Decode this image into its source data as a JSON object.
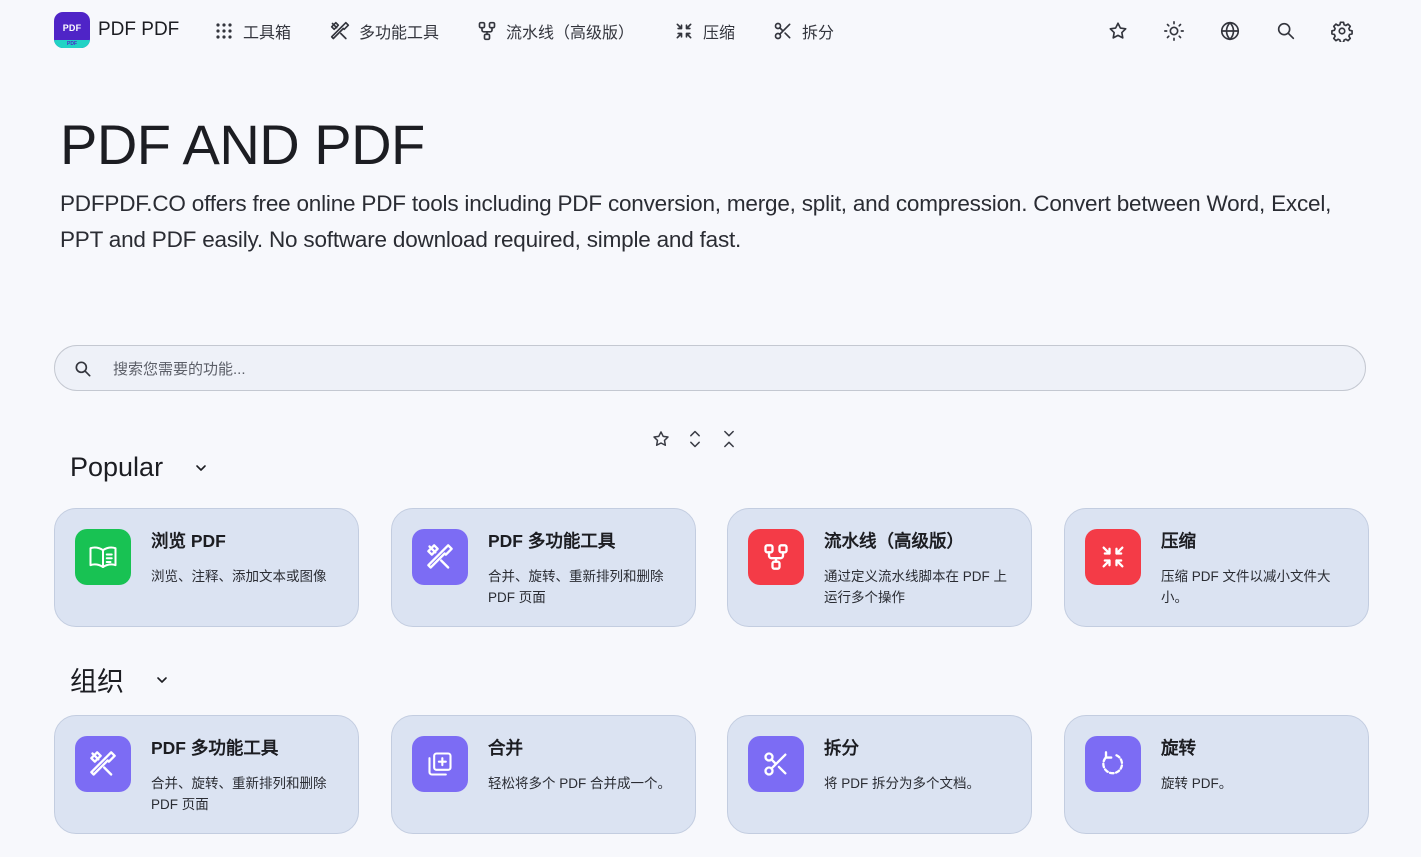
{
  "brand": {
    "logo_text": "PDF",
    "logo_sub": "PDF",
    "name": "PDF PDF"
  },
  "nav": [
    {
      "label": "工具箱",
      "icon": "grid-icon"
    },
    {
      "label": "多功能工具",
      "icon": "tools-icon"
    },
    {
      "label": "流水线（高级版）",
      "icon": "pipeline-icon"
    },
    {
      "label": "压缩",
      "icon": "compress-icon"
    },
    {
      "label": "拆分",
      "icon": "scissors-icon"
    }
  ],
  "top_icons": [
    "star-icon",
    "sun-icon",
    "globe-icon",
    "search-icon",
    "gear-icon"
  ],
  "hero": {
    "title": "PDF AND PDF",
    "description": "PDFPDF.CO offers free online PDF tools including PDF conversion, merge, split, and compression. Convert between Word, Excel, PPT and PDF easily. No software download required, simple and fast."
  },
  "search": {
    "placeholder": "搜索您需要的功能...",
    "value": ""
  },
  "controls": [
    "star-outline-icon",
    "expand-all-icon",
    "collapse-all-icon"
  ],
  "sections": [
    {
      "title": "Popular",
      "cards": [
        {
          "title": "浏览 PDF",
          "desc": "浏览、注释、添加文本或图像",
          "icon": "book-icon",
          "color": "#18c253"
        },
        {
          "title": "PDF 多功能工具",
          "desc": "合并、旋转、重新排列和删除 PDF 页面",
          "icon": "tools-icon",
          "color": "#7c6cf4"
        },
        {
          "title": "流水线（高级版）",
          "desc": "通过定义流水线脚本在 PDF 上运行多个操作",
          "icon": "pipeline-icon",
          "color": "#f43b47"
        },
        {
          "title": "压缩",
          "desc": "压缩 PDF 文件以减小文件大小。",
          "icon": "compress-icon",
          "color": "#f43b47"
        }
      ]
    },
    {
      "title": "组织",
      "cards": [
        {
          "title": "PDF 多功能工具",
          "desc": "合并、旋转、重新排列和删除 PDF 页面",
          "icon": "tools-icon",
          "color": "#7c6cf4"
        },
        {
          "title": "合并",
          "desc": "轻松将多个 PDF 合并成一个。",
          "icon": "merge-icon",
          "color": "#7c6cf4"
        },
        {
          "title": "拆分",
          "desc": "将 PDF 拆分为多个文档。",
          "icon": "scissors-icon",
          "color": "#7c6cf4"
        },
        {
          "title": "旋转",
          "desc": "旋转 PDF。",
          "icon": "rotate-icon",
          "color": "#7c6cf4"
        }
      ]
    }
  ]
}
